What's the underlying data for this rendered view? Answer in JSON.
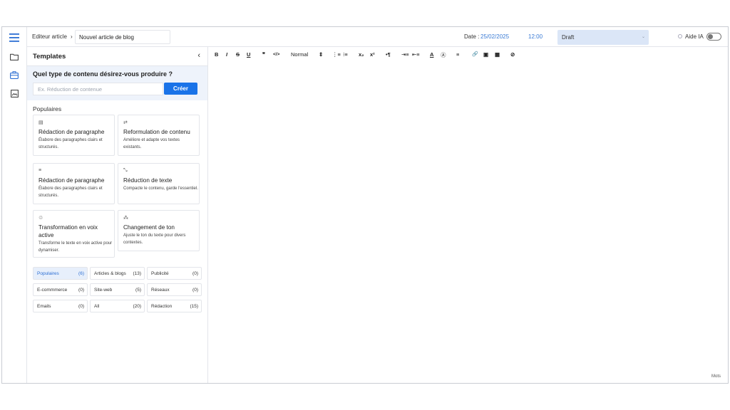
{
  "header": {
    "breadcrumb_editor": "Editeur article",
    "breadcrumb_sep": "›",
    "article_title": "Nouvel article de blog",
    "date_label": "Date :",
    "date_value": "25/02/2025",
    "time_value": "12:00",
    "status": "Draft",
    "ai_label": "Aide IA",
    "ai_enabled": false
  },
  "rail": {
    "icons": [
      "menu-icon",
      "folder-icon",
      "briefcase-icon",
      "image-icon"
    ]
  },
  "templates": {
    "title": "Templates",
    "collapse_glyph": "‹",
    "question": "Quel type de contenu désirez-vous produire ?",
    "input_placeholder": "Ex. Réduction de contenue",
    "create_label": "Créer",
    "popular_heading": "Populaires",
    "cards": [
      {
        "icon": "▤",
        "title": "Rédaction de paragraphe",
        "desc": "Élabore des paragraphes clairs et structurés."
      },
      {
        "icon": "⇄",
        "title": "Reformulation de contenu",
        "desc": "Améliore et adapte vos textes existants."
      },
      {
        "icon": "≡",
        "title": "Rédaction de paragraphe",
        "desc": "Élabore des paragraphes clairs et structurés."
      },
      {
        "icon": "⤡",
        "title": "Réduction de texte",
        "desc": "Compacte le contenu, garde l'essentiel."
      },
      {
        "icon": "♲",
        "title": "Transformation en voix active",
        "desc": "Transforme le texte en voix active pour dynamiser."
      },
      {
        "icon": "⁂",
        "title": "Changement de ton",
        "desc": "Ajuste le ton du texte pour divers contextes."
      }
    ],
    "categories": [
      {
        "label": "Populaires",
        "count": "(6)"
      },
      {
        "label": "Articles & blogs",
        "count": "(13)"
      },
      {
        "label": "Publicité",
        "count": "(0)"
      },
      {
        "label": "E-commmerce",
        "count": "(0)"
      },
      {
        "label": "Site-web",
        "count": "(5)"
      },
      {
        "label": "Réseaux",
        "count": "(0)"
      },
      {
        "label": "Emails",
        "count": "(0)"
      },
      {
        "label": "All",
        "count": "(20)"
      },
      {
        "label": "Rédaction",
        "count": "(15)"
      }
    ]
  },
  "toolbar": {
    "bold": "B",
    "italic": "I",
    "strike": "S",
    "underline": "U",
    "quote": "❞",
    "code": "</>",
    "style": "Normal",
    "style_chev": "⇕",
    "ordered_list": "⋮≡",
    "bullet_list": "⁝≡",
    "subscript": "x₂",
    "superscript": "x²",
    "direction": "•¶",
    "indent_in": "⇥≡",
    "indent_out": "⇤≡",
    "font_color": "A",
    "bg_color": "Ⓐ",
    "align": "≡",
    "link": "🔗",
    "image": "▣",
    "video": "▦",
    "clean": "⊘"
  },
  "editor": {
    "words_label": "Mots"
  }
}
